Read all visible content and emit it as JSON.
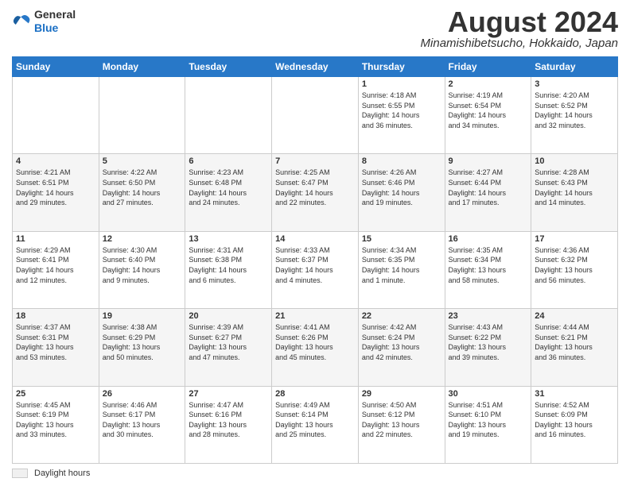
{
  "header": {
    "logo": {
      "general": "General",
      "blue": "Blue"
    },
    "title": "August 2024",
    "location": "Minamishibetsucho, Hokkaido, Japan"
  },
  "days_of_week": [
    "Sunday",
    "Monday",
    "Tuesday",
    "Wednesday",
    "Thursday",
    "Friday",
    "Saturday"
  ],
  "weeks": [
    [
      {
        "day": "",
        "info": ""
      },
      {
        "day": "",
        "info": ""
      },
      {
        "day": "",
        "info": ""
      },
      {
        "day": "",
        "info": ""
      },
      {
        "day": "1",
        "info": "Sunrise: 4:18 AM\nSunset: 6:55 PM\nDaylight: 14 hours\nand 36 minutes."
      },
      {
        "day": "2",
        "info": "Sunrise: 4:19 AM\nSunset: 6:54 PM\nDaylight: 14 hours\nand 34 minutes."
      },
      {
        "day": "3",
        "info": "Sunrise: 4:20 AM\nSunset: 6:52 PM\nDaylight: 14 hours\nand 32 minutes."
      }
    ],
    [
      {
        "day": "4",
        "info": "Sunrise: 4:21 AM\nSunset: 6:51 PM\nDaylight: 14 hours\nand 29 minutes."
      },
      {
        "day": "5",
        "info": "Sunrise: 4:22 AM\nSunset: 6:50 PM\nDaylight: 14 hours\nand 27 minutes."
      },
      {
        "day": "6",
        "info": "Sunrise: 4:23 AM\nSunset: 6:48 PM\nDaylight: 14 hours\nand 24 minutes."
      },
      {
        "day": "7",
        "info": "Sunrise: 4:25 AM\nSunset: 6:47 PM\nDaylight: 14 hours\nand 22 minutes."
      },
      {
        "day": "8",
        "info": "Sunrise: 4:26 AM\nSunset: 6:46 PM\nDaylight: 14 hours\nand 19 minutes."
      },
      {
        "day": "9",
        "info": "Sunrise: 4:27 AM\nSunset: 6:44 PM\nDaylight: 14 hours\nand 17 minutes."
      },
      {
        "day": "10",
        "info": "Sunrise: 4:28 AM\nSunset: 6:43 PM\nDaylight: 14 hours\nand 14 minutes."
      }
    ],
    [
      {
        "day": "11",
        "info": "Sunrise: 4:29 AM\nSunset: 6:41 PM\nDaylight: 14 hours\nand 12 minutes."
      },
      {
        "day": "12",
        "info": "Sunrise: 4:30 AM\nSunset: 6:40 PM\nDaylight: 14 hours\nand 9 minutes."
      },
      {
        "day": "13",
        "info": "Sunrise: 4:31 AM\nSunset: 6:38 PM\nDaylight: 14 hours\nand 6 minutes."
      },
      {
        "day": "14",
        "info": "Sunrise: 4:33 AM\nSunset: 6:37 PM\nDaylight: 14 hours\nand 4 minutes."
      },
      {
        "day": "15",
        "info": "Sunrise: 4:34 AM\nSunset: 6:35 PM\nDaylight: 14 hours\nand 1 minute."
      },
      {
        "day": "16",
        "info": "Sunrise: 4:35 AM\nSunset: 6:34 PM\nDaylight: 13 hours\nand 58 minutes."
      },
      {
        "day": "17",
        "info": "Sunrise: 4:36 AM\nSunset: 6:32 PM\nDaylight: 13 hours\nand 56 minutes."
      }
    ],
    [
      {
        "day": "18",
        "info": "Sunrise: 4:37 AM\nSunset: 6:31 PM\nDaylight: 13 hours\nand 53 minutes."
      },
      {
        "day": "19",
        "info": "Sunrise: 4:38 AM\nSunset: 6:29 PM\nDaylight: 13 hours\nand 50 minutes."
      },
      {
        "day": "20",
        "info": "Sunrise: 4:39 AM\nSunset: 6:27 PM\nDaylight: 13 hours\nand 47 minutes."
      },
      {
        "day": "21",
        "info": "Sunrise: 4:41 AM\nSunset: 6:26 PM\nDaylight: 13 hours\nand 45 minutes."
      },
      {
        "day": "22",
        "info": "Sunrise: 4:42 AM\nSunset: 6:24 PM\nDaylight: 13 hours\nand 42 minutes."
      },
      {
        "day": "23",
        "info": "Sunrise: 4:43 AM\nSunset: 6:22 PM\nDaylight: 13 hours\nand 39 minutes."
      },
      {
        "day": "24",
        "info": "Sunrise: 4:44 AM\nSunset: 6:21 PM\nDaylight: 13 hours\nand 36 minutes."
      }
    ],
    [
      {
        "day": "25",
        "info": "Sunrise: 4:45 AM\nSunset: 6:19 PM\nDaylight: 13 hours\nand 33 minutes."
      },
      {
        "day": "26",
        "info": "Sunrise: 4:46 AM\nSunset: 6:17 PM\nDaylight: 13 hours\nand 30 minutes."
      },
      {
        "day": "27",
        "info": "Sunrise: 4:47 AM\nSunset: 6:16 PM\nDaylight: 13 hours\nand 28 minutes."
      },
      {
        "day": "28",
        "info": "Sunrise: 4:49 AM\nSunset: 6:14 PM\nDaylight: 13 hours\nand 25 minutes."
      },
      {
        "day": "29",
        "info": "Sunrise: 4:50 AM\nSunset: 6:12 PM\nDaylight: 13 hours\nand 22 minutes."
      },
      {
        "day": "30",
        "info": "Sunrise: 4:51 AM\nSunset: 6:10 PM\nDaylight: 13 hours\nand 19 minutes."
      },
      {
        "day": "31",
        "info": "Sunrise: 4:52 AM\nSunset: 6:09 PM\nDaylight: 13 hours\nand 16 minutes."
      }
    ]
  ],
  "footer": {
    "legend_label": "Daylight hours"
  }
}
